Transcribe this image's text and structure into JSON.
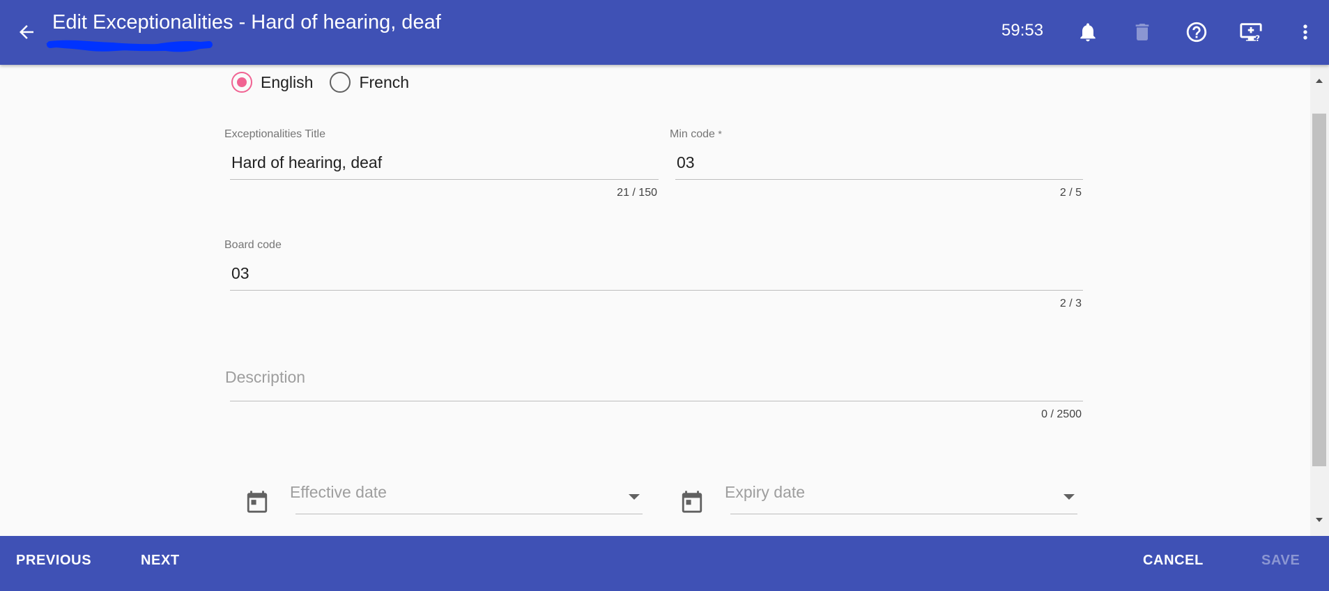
{
  "header": {
    "title": "Edit Exceptionalities - Hard of hearing, deaf",
    "timer": "59:53",
    "icons": [
      "arrow-back-icon",
      "bell-icon",
      "trash-icon",
      "help-icon",
      "remote-support-icon",
      "more-vert-icon"
    ]
  },
  "language": {
    "options": [
      {
        "label": "English",
        "checked": true
      },
      {
        "label": "French",
        "checked": false
      }
    ]
  },
  "form": {
    "title_field": {
      "label": "Exceptionalities Title",
      "value": "Hard of hearing, deaf",
      "counter": "21 / 150"
    },
    "min_code_field": {
      "label": "Min code",
      "required_mark": "*",
      "value": "03",
      "counter": "2 / 5"
    },
    "board_code_field": {
      "label": "Board code",
      "value": "03",
      "counter": "2 / 3"
    },
    "description_field": {
      "placeholder": "Description",
      "value": "",
      "counter": "0 / 2500"
    },
    "effective_date": {
      "placeholder": "Effective date"
    },
    "expiry_date": {
      "placeholder": "Expiry date"
    }
  },
  "footer": {
    "previous_label": "PREVIOUS",
    "next_label": "NEXT",
    "cancel_label": "CANCEL",
    "save_label": "SAVE"
  },
  "colors": {
    "primary": "#3f51b5",
    "radio_accent": "#f06292",
    "redaction": "#0033ff"
  }
}
